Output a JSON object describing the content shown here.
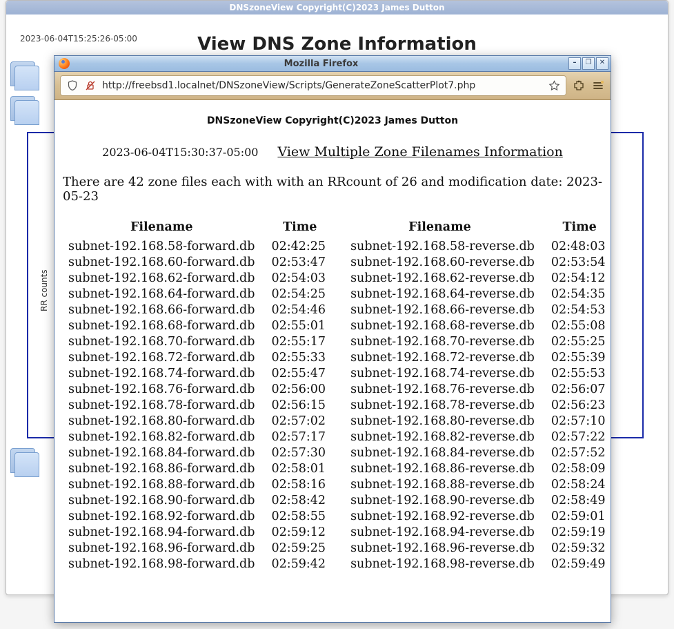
{
  "outer": {
    "title": "DNSzoneView Copyright(C)2023 James Dutton",
    "heading": "View DNS Zone Information",
    "timestamp": "2023-06-04T15:25:26-05:00",
    "ylabel": "RR counts"
  },
  "firefox": {
    "title": "Mozilla Firefox",
    "url": "http://freebsd1.localnet/DNSzoneView/Scripts/GenerateZoneScatterPlot7.php",
    "win_min": "–",
    "win_max": "❐",
    "win_close": "✕"
  },
  "page": {
    "copyright": "DNSzoneView Copyright(C)2023 James Dutton",
    "timestamp": "2023-06-04T15:30:37-05:00",
    "link_text": "View Multiple Zone Filenames Information",
    "summary": "There are 42 zone files each with with an RRcount of 26 and modification date: 2023-05-23",
    "headers": {
      "fname": "Filename",
      "time": "Time"
    },
    "rows": [
      {
        "f1": "subnet-192.168.58-forward.db",
        "t1": "02:42:25",
        "f2": "subnet-192.168.58-reverse.db",
        "t2": "02:48:03"
      },
      {
        "f1": "subnet-192.168.60-forward.db",
        "t1": "02:53:47",
        "f2": "subnet-192.168.60-reverse.db",
        "t2": "02:53:54"
      },
      {
        "f1": "subnet-192.168.62-forward.db",
        "t1": "02:54:03",
        "f2": "subnet-192.168.62-reverse.db",
        "t2": "02:54:12"
      },
      {
        "f1": "subnet-192.168.64-forward.db",
        "t1": "02:54:25",
        "f2": "subnet-192.168.64-reverse.db",
        "t2": "02:54:35"
      },
      {
        "f1": "subnet-192.168.66-forward.db",
        "t1": "02:54:46",
        "f2": "subnet-192.168.66-reverse.db",
        "t2": "02:54:53"
      },
      {
        "f1": "subnet-192.168.68-forward.db",
        "t1": "02:55:01",
        "f2": "subnet-192.168.68-reverse.db",
        "t2": "02:55:08"
      },
      {
        "f1": "subnet-192.168.70-forward.db",
        "t1": "02:55:17",
        "f2": "subnet-192.168.70-reverse.db",
        "t2": "02:55:25"
      },
      {
        "f1": "subnet-192.168.72-forward.db",
        "t1": "02:55:33",
        "f2": "subnet-192.168.72-reverse.db",
        "t2": "02:55:39"
      },
      {
        "f1": "subnet-192.168.74-forward.db",
        "t1": "02:55:47",
        "f2": "subnet-192.168.74-reverse.db",
        "t2": "02:55:53"
      },
      {
        "f1": "subnet-192.168.76-forward.db",
        "t1": "02:56:00",
        "f2": "subnet-192.168.76-reverse.db",
        "t2": "02:56:07"
      },
      {
        "f1": "subnet-192.168.78-forward.db",
        "t1": "02:56:15",
        "f2": "subnet-192.168.78-reverse.db",
        "t2": "02:56:23"
      },
      {
        "f1": "subnet-192.168.80-forward.db",
        "t1": "02:57:02",
        "f2": "subnet-192.168.80-reverse.db",
        "t2": "02:57:10"
      },
      {
        "f1": "subnet-192.168.82-forward.db",
        "t1": "02:57:17",
        "f2": "subnet-192.168.82-reverse.db",
        "t2": "02:57:22"
      },
      {
        "f1": "subnet-192.168.84-forward.db",
        "t1": "02:57:30",
        "f2": "subnet-192.168.84-reverse.db",
        "t2": "02:57:52"
      },
      {
        "f1": "subnet-192.168.86-forward.db",
        "t1": "02:58:01",
        "f2": "subnet-192.168.86-reverse.db",
        "t2": "02:58:09"
      },
      {
        "f1": "subnet-192.168.88-forward.db",
        "t1": "02:58:16",
        "f2": "subnet-192.168.88-reverse.db",
        "t2": "02:58:24"
      },
      {
        "f1": "subnet-192.168.90-forward.db",
        "t1": "02:58:42",
        "f2": "subnet-192.168.90-reverse.db",
        "t2": "02:58:49"
      },
      {
        "f1": "subnet-192.168.92-forward.db",
        "t1": "02:58:55",
        "f2": "subnet-192.168.92-reverse.db",
        "t2": "02:59:01"
      },
      {
        "f1": "subnet-192.168.94-forward.db",
        "t1": "02:59:12",
        "f2": "subnet-192.168.94-reverse.db",
        "t2": "02:59:19"
      },
      {
        "f1": "subnet-192.168.96-forward.db",
        "t1": "02:59:25",
        "f2": "subnet-192.168.96-reverse.db",
        "t2": "02:59:32"
      },
      {
        "f1": "subnet-192.168.98-forward.db",
        "t1": "02:59:42",
        "f2": "subnet-192.168.98-reverse.db",
        "t2": "02:59:49"
      }
    ]
  }
}
